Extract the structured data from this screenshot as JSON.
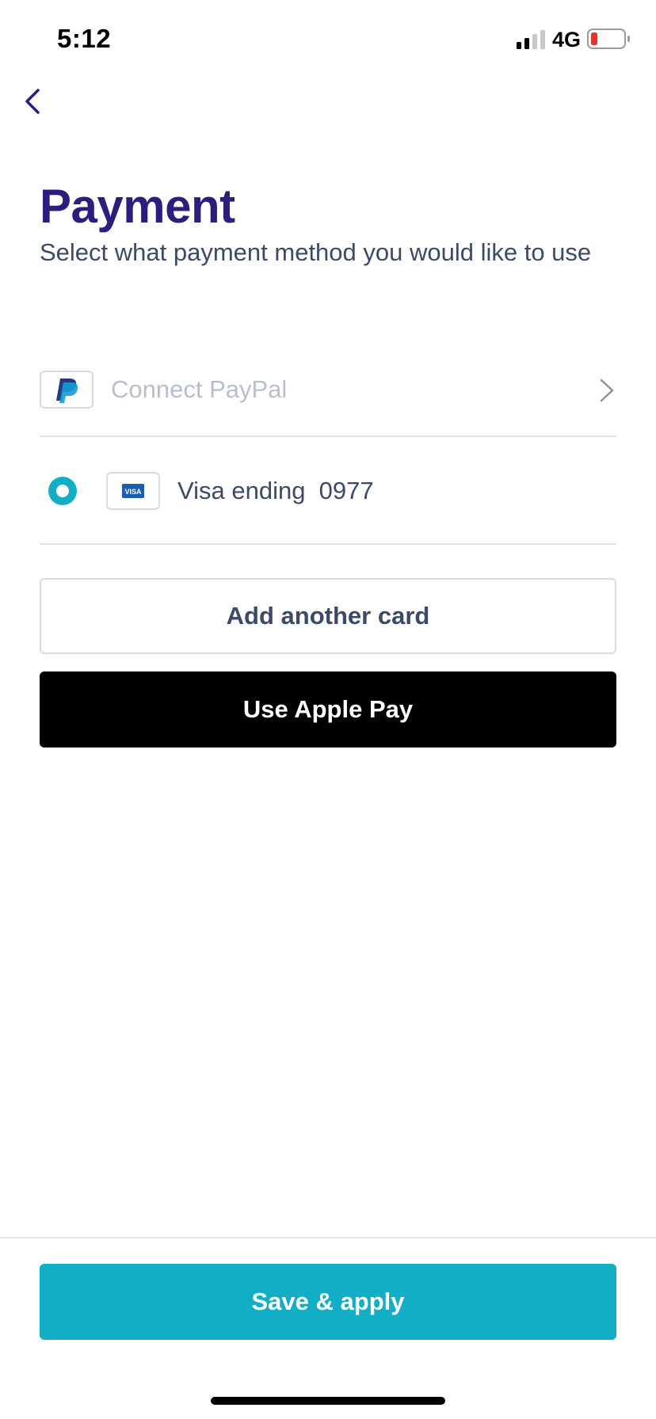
{
  "status_bar": {
    "time": "5:12",
    "network": "4G",
    "signal_icon": "cellular-signal-icon",
    "battery_icon": "battery-low-icon",
    "battery_color": "#e8332e"
  },
  "nav": {
    "back_icon": "chevron-left-icon"
  },
  "header": {
    "title": "Payment",
    "subtitle": "Select what payment method you would like to use"
  },
  "methods": {
    "paypal": {
      "label": "Connect PayPal",
      "logo": "paypal-logo-icon",
      "trailing_icon": "chevron-right-icon"
    },
    "visa": {
      "label": "Visa ending  0977",
      "logo": "visa-logo-icon",
      "logo_text": "VISA",
      "selected": true
    }
  },
  "buttons": {
    "add_card": "Add another card",
    "apple_pay": "Use Apple Pay",
    "save": "Save & apply"
  },
  "colors": {
    "title": "#2f1d7d",
    "accent": "#12aec6",
    "text": "#3d4a66",
    "muted": "#b8bfcc",
    "apple_pay_bg": "#000000"
  }
}
